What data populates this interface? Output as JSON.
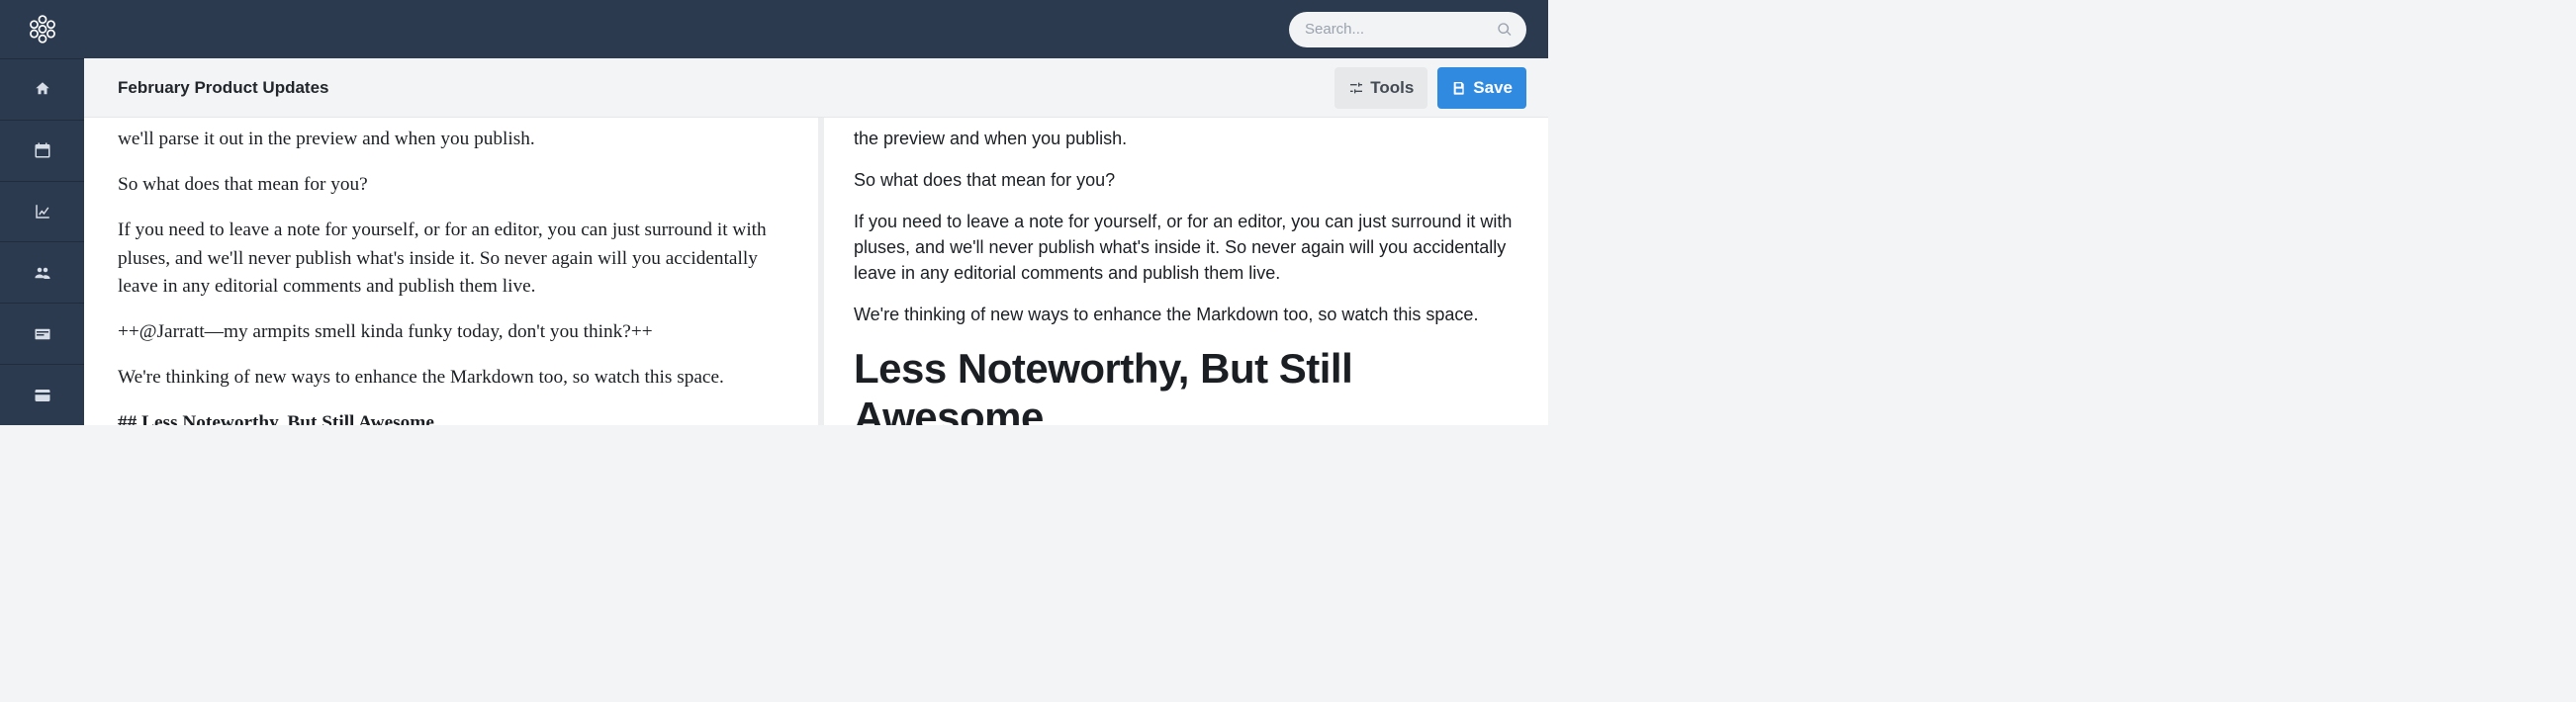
{
  "search": {
    "placeholder": "Search..."
  },
  "toolbar": {
    "title": "February Product Updates",
    "tools_label": "Tools",
    "save_label": "Save"
  },
  "sidebar_icons": [
    "home",
    "calendar",
    "chart",
    "users",
    "card",
    "credit-card"
  ],
  "editor": {
    "p1": "we'll parse it out in the preview and when you publish.",
    "p2": "So what does that mean for you?",
    "p3": "If you need to leave a note for yourself, or for an editor, you can just surround it with pluses, and we'll never publish what's inside it. So never again will you accidentally leave in any editorial comments and publish them live.",
    "p4": "++@Jarratt—my armpits smell kinda funky today, don't you think?++",
    "p5": "We're thinking of new ways to enhance the Markdown too, so watch this space.",
    "h2": "## Less Noteworthy, But Still Awesome"
  },
  "preview": {
    "p1": "the preview and when you publish.",
    "p2": "So what does that mean for you?",
    "p3": "If you need to leave a note for yourself, or for an editor, you can just surround it with pluses, and we'll never publish what's inside it. So never again will you accidentally leave in any editorial comments and publish them live.",
    "p4": "We're thinking of new ways to enhance the Markdown too, so watch this space.",
    "h2": "Less Noteworthy, But Still Awesome"
  }
}
